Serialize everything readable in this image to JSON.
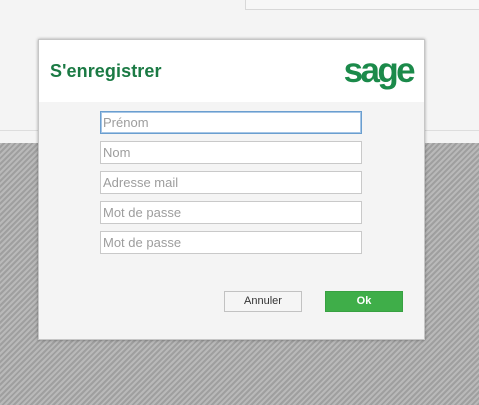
{
  "dialog": {
    "title": "S'enregistrer",
    "logo_text": "sage",
    "brand_color": "#1b7a44"
  },
  "form": {
    "fields": [
      {
        "placeholder": "Prénom",
        "value": "",
        "focused": true
      },
      {
        "placeholder": "Nom",
        "value": ""
      },
      {
        "placeholder": "Adresse mail",
        "value": ""
      },
      {
        "placeholder": "Mot de passe",
        "value": ""
      },
      {
        "placeholder": "Mot de passe",
        "value": ""
      }
    ]
  },
  "buttons": {
    "cancel_label": "Annuler",
    "ok_label": "Ok",
    "ok_color": "#3fae49"
  }
}
